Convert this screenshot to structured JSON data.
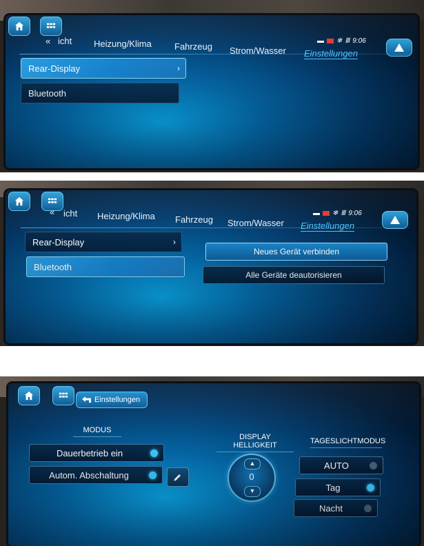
{
  "panel1": {
    "nav_back": "«",
    "tabs": [
      "icht",
      "Heizung/Klima",
      "Fahrzeug",
      "Strom/Wasser",
      "Einstellungen"
    ],
    "time": "9:06",
    "list": [
      {
        "label": "Rear-Display",
        "chevron": "›"
      },
      {
        "label": "Bluetooth"
      }
    ]
  },
  "panel2": {
    "nav_back": "«",
    "tabs": [
      "icht",
      "Heizung/Klima",
      "Fahrzeug",
      "Strom/Wasser",
      "Einstellungen"
    ],
    "time": "9:06",
    "list": [
      {
        "label": "Rear-Display",
        "chevron": "›"
      },
      {
        "label": "Bluetooth"
      }
    ],
    "actions": [
      "Neues Gerät verbinden",
      "Alle Geräte deautorisieren"
    ]
  },
  "panel3": {
    "back_label": "Einstellungen",
    "modus": {
      "heading": "MODUS",
      "options": [
        "Dauerbetrieb ein",
        "Autom. Abschaltung"
      ]
    },
    "helligkeit": {
      "heading": "DISPLAY HELLIGKEIT",
      "value": "0"
    },
    "tageslicht": {
      "heading": "TAGESLICHTMODUS",
      "options": [
        "AUTO",
        "Tag",
        "Nacht"
      ]
    }
  },
  "colors": {
    "accent": "#52c4ff",
    "selected": "#1b82cc",
    "indicator_on": "#3ec9ff"
  }
}
